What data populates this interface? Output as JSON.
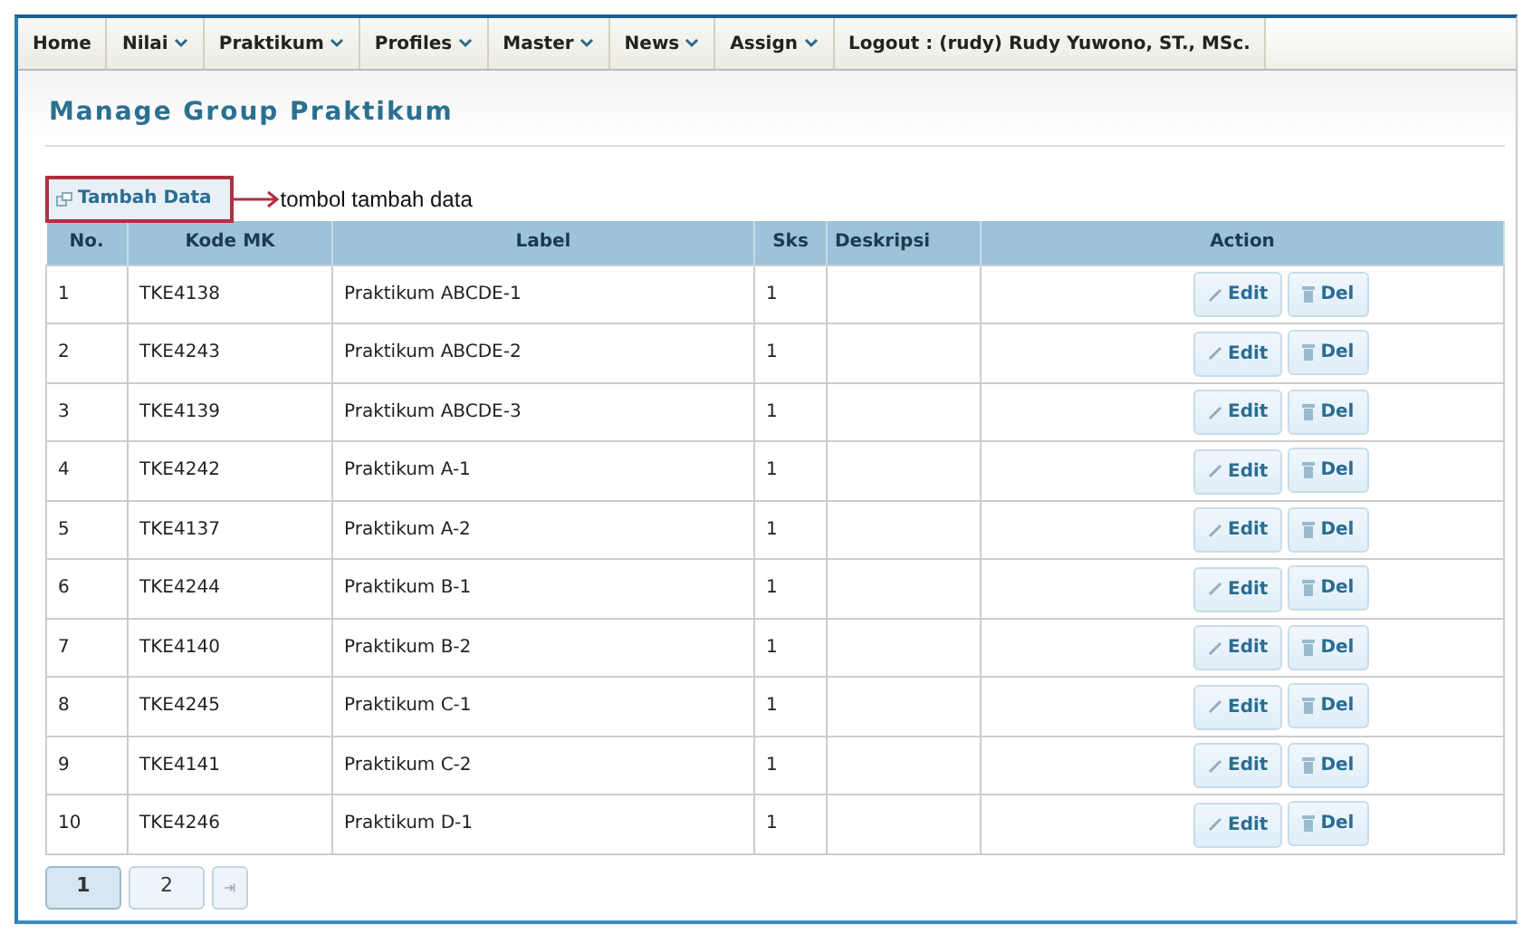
{
  "nav": [
    {
      "label": "Home",
      "dropdown": false
    },
    {
      "label": "Nilai",
      "dropdown": true
    },
    {
      "label": "Praktikum",
      "dropdown": true
    },
    {
      "label": "Profiles",
      "dropdown": true
    },
    {
      "label": "Master",
      "dropdown": true
    },
    {
      "label": "News",
      "dropdown": true
    },
    {
      "label": "Assign",
      "dropdown": true
    },
    {
      "label": "Logout : (rudy) Rudy Yuwono, ST., MSc.",
      "dropdown": false
    }
  ],
  "page_title": "Manage Group Praktikum",
  "add_button": "Tambah Data",
  "annotation": "tombol tambah data",
  "table": {
    "columns": [
      "No.",
      "Kode MK",
      "Label",
      "Sks",
      "Deskripsi",
      "Action"
    ],
    "rows": [
      {
        "no": "1",
        "kode": "TKE4138",
        "label": "Praktikum ABCDE-1",
        "sks": "1",
        "actions": [
          "Edit",
          "Del"
        ]
      },
      {
        "no": "2",
        "kode": "TKE4243",
        "label": "Praktikum ABCDE-2",
        "sks": "1",
        "actions": [
          "Edit",
          "Del"
        ]
      },
      {
        "no": "3",
        "kode": "TKE4139",
        "label": "Praktikum ABCDE-3",
        "sks": "1",
        "actions": [
          "Edit",
          "Del"
        ]
      },
      {
        "no": "4",
        "kode": "TKE4242",
        "label": "Praktikum A-1",
        "sks": "1",
        "actions": [
          "Edit",
          "Del"
        ]
      },
      {
        "no": "5",
        "kode": "TKE4137",
        "label": "Praktikum A-2",
        "sks": "1",
        "actions": [
          "Edit",
          "Del"
        ]
      },
      {
        "no": "6",
        "kode": "TKE4244",
        "label": "Praktikum B-1",
        "sks": "1",
        "actions": [
          "Edit",
          "Del"
        ]
      },
      {
        "no": "7",
        "kode": "TKE4140",
        "label": "Praktikum B-2",
        "sks": "1",
        "actions": [
          "Edit",
          "Del"
        ]
      },
      {
        "no": "8",
        "kode": "TKE4245",
        "label": "Praktikum C-1",
        "sks": "1",
        "actions": [
          "Edit",
          "Del"
        ]
      },
      {
        "no": "9",
        "kode": "TKE4141",
        "label": "Praktikum C-2",
        "sks": "1",
        "actions": [
          "Edit",
          "Del"
        ]
      },
      {
        "no": "10",
        "kode": "TKE4246",
        "label": "Praktikum D-1",
        "sks": "1",
        "actions": [
          "Edit",
          "Del"
        ]
      }
    ]
  },
  "pagination": [
    {
      "label": "1",
      "selected": true
    },
    {
      "label": "2",
      "selected": false
    }
  ]
}
